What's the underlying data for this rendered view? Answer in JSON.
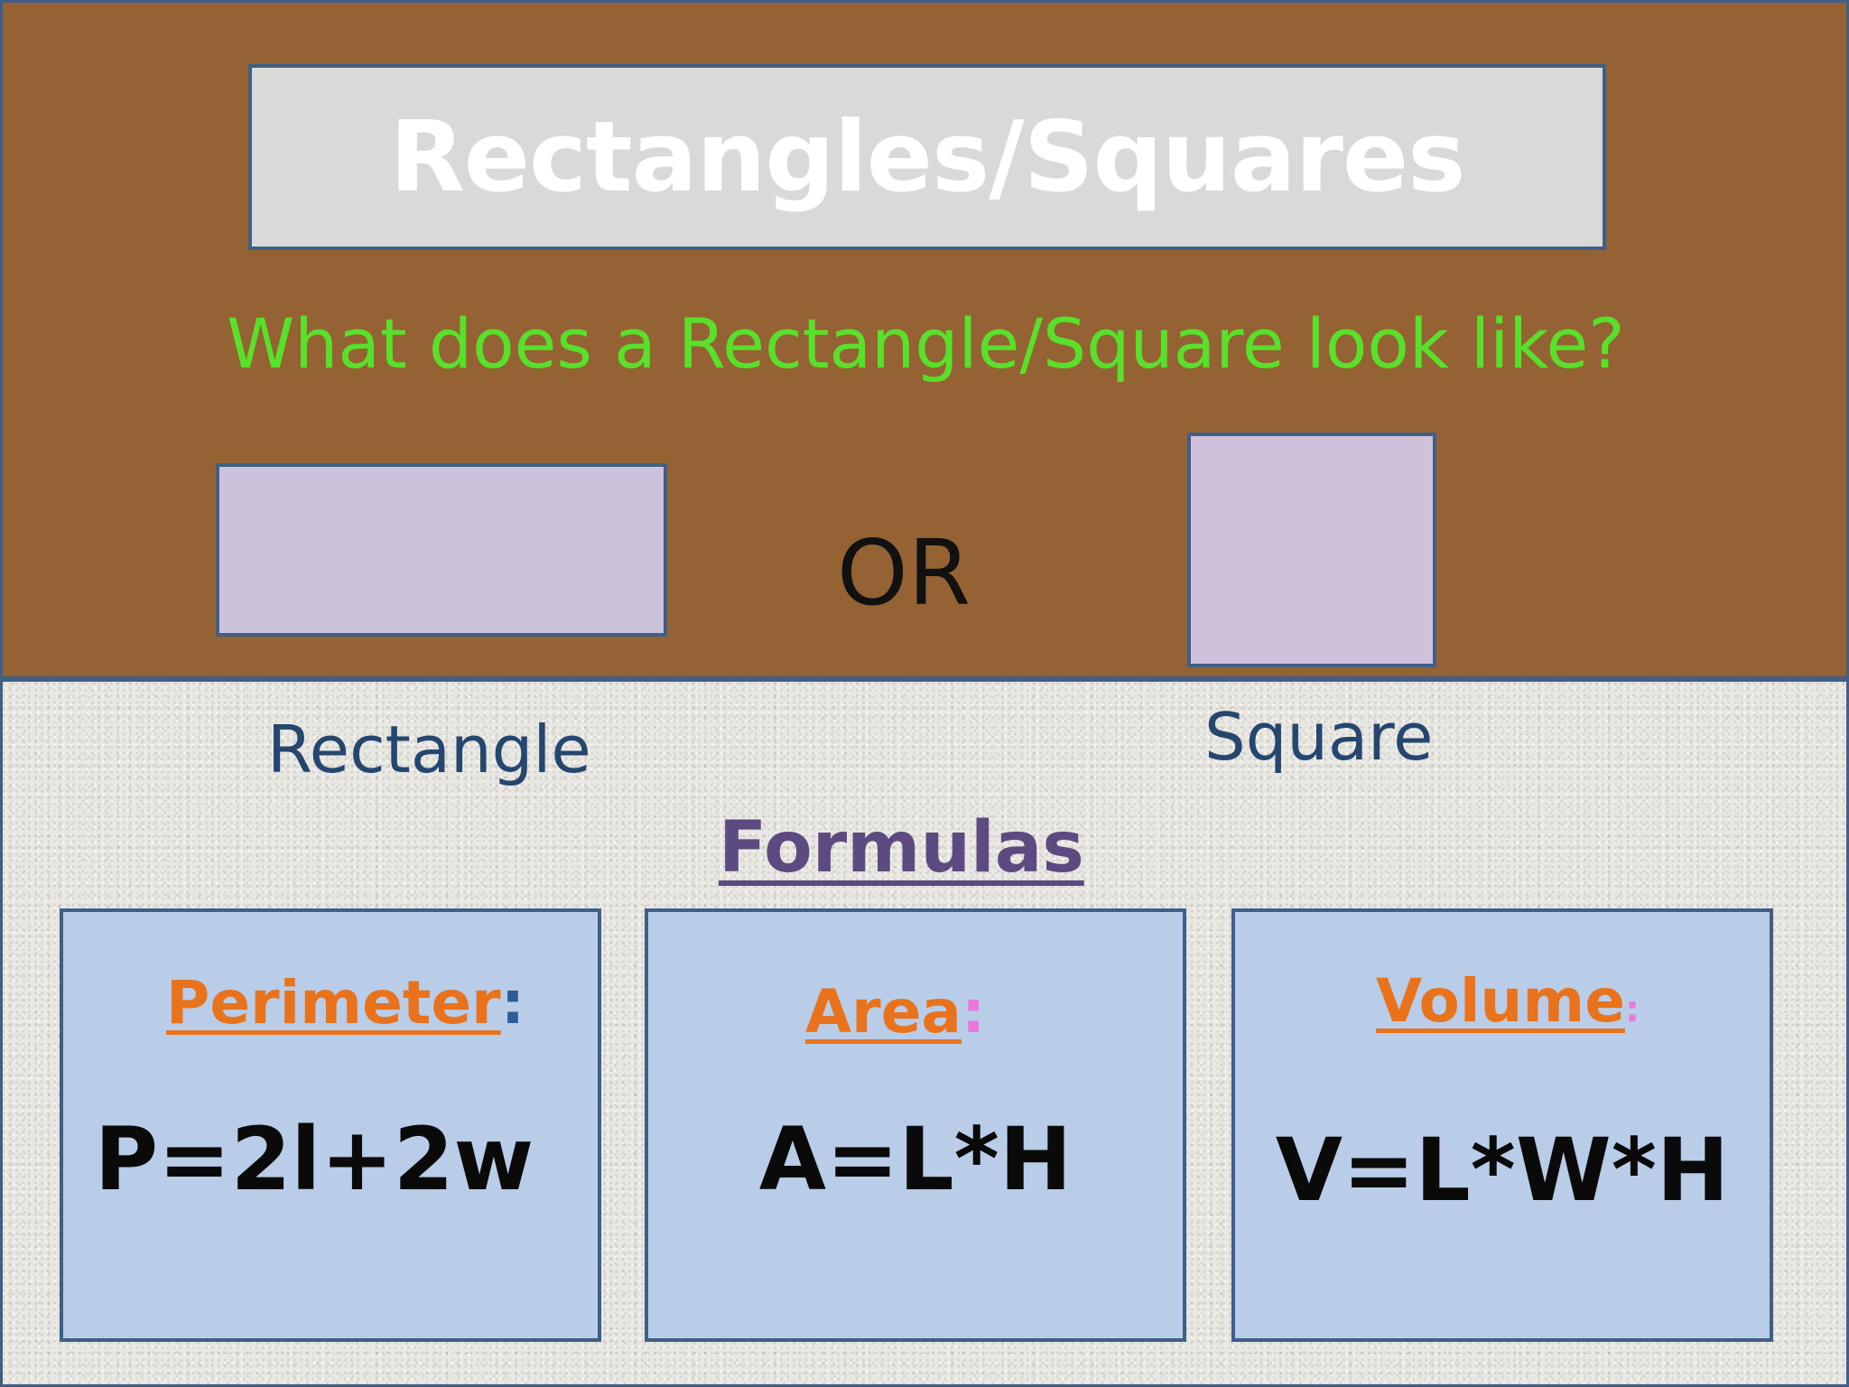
{
  "slide": {
    "title": "Rectangles/Squares",
    "question": "What does a Rectangle/Square look like?",
    "separator": "OR",
    "shape_labels": {
      "rectangle": "Rectangle",
      "square": "Square"
    },
    "formulas_heading": "Formulas",
    "cards": [
      {
        "label": "Perimeter",
        "colon": ":",
        "formula": "P=2l+2w"
      },
      {
        "label": "Area",
        "colon": ":",
        "formula": "A=L*H"
      },
      {
        "label": "Volume",
        "colon": ":",
        "formula": "V=L*W*H"
      }
    ]
  },
  "colors": {
    "top_background": "#956233",
    "title_box": "#d9dad8",
    "question_text": "#58e02a",
    "shape_fill": "#cbc3db",
    "card_fill": "#b9cde8",
    "label_orange": "#e8731c",
    "heading_purple": "#5c4a80",
    "border_blue": "#3f5f86"
  }
}
